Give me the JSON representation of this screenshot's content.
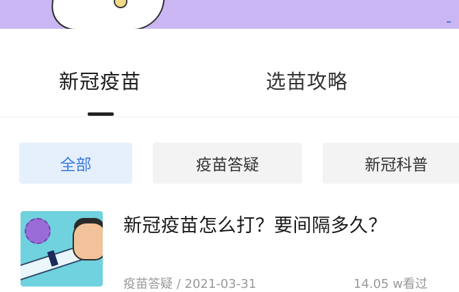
{
  "tabs": [
    {
      "label": "新冠疫苗",
      "active": true
    },
    {
      "label": "选苗攻略",
      "active": false
    }
  ],
  "filters": [
    {
      "label": "全部",
      "selected": true
    },
    {
      "label": "疫苗答疑",
      "selected": false
    },
    {
      "label": "新冠科普",
      "selected": false
    }
  ],
  "article": {
    "title": "新冠疫苗怎么打？要间隔多久？",
    "meta": "疫苗答疑 / 2021-03-31",
    "views": "14.05 w看过"
  },
  "colors": {
    "accent": "#3b7be0",
    "banner": "#c9b6f2",
    "chip_selected_bg": "#e6f0fc",
    "chip_bg": "#f3f3f3"
  }
}
